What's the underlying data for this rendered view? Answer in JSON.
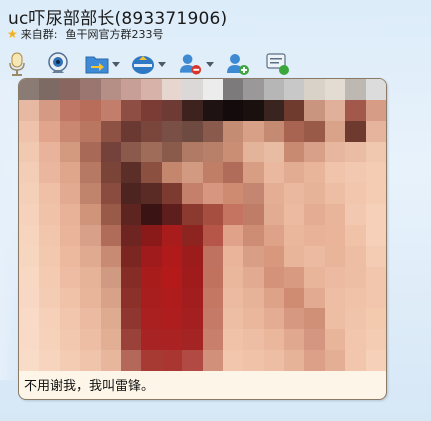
{
  "window": {
    "title": "uc吓尿部部长(893371906)",
    "from_label": "来自群:",
    "group_name": "鱼干网官方群233号"
  },
  "toolbar": {
    "buttons": [
      {
        "name": "voice-call-button",
        "icon": "microphone-icon"
      },
      {
        "name": "video-call-button",
        "icon": "webcam-icon"
      },
      {
        "name": "send-file-button",
        "icon": "folder-transfer-icon",
        "has_dropdown": true
      },
      {
        "name": "remote-assist-button",
        "icon": "remote-icon",
        "has_dropdown": true
      },
      {
        "name": "block-user-button",
        "icon": "user-remove-icon",
        "has_dropdown": true
      },
      {
        "name": "add-friend-button",
        "icon": "user-add-icon"
      },
      {
        "name": "message-record-button",
        "icon": "chat-log-icon"
      }
    ]
  },
  "message": {
    "text": "不用谢我，我叫雷锋。",
    "image_description_colors": [
      "#e8b59a",
      "#9c1c1c",
      "#5c2a22",
      "#f3cdb5"
    ]
  }
}
